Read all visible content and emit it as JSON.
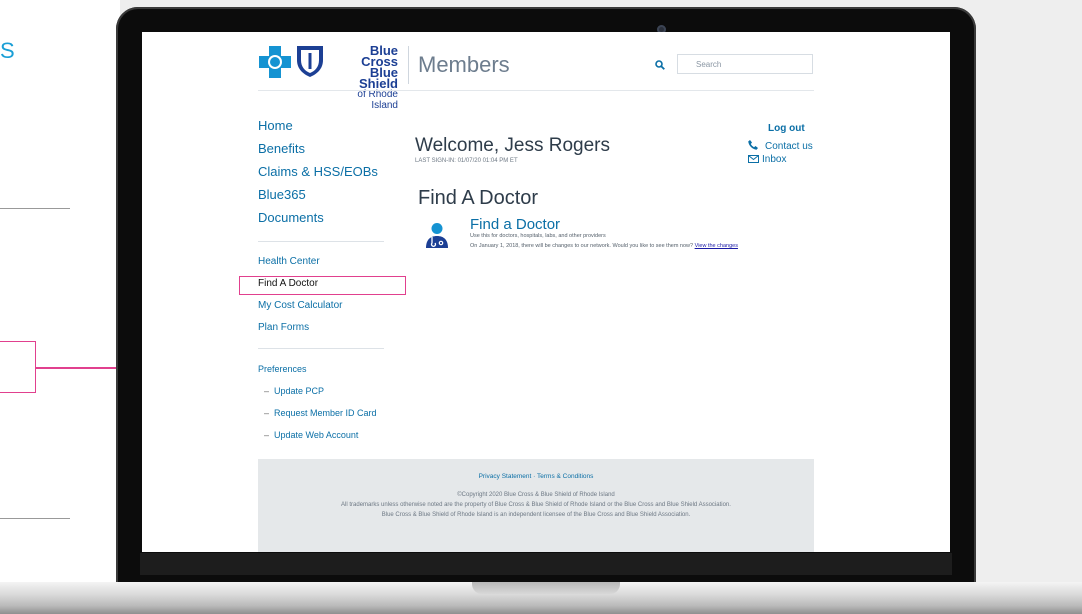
{
  "slide": {
    "fragment_letter": "S",
    "accent_color": "#1a9fd6",
    "highlight_color": "#e1408e"
  },
  "header": {
    "logo_line1": "Blue Cross",
    "logo_line2": "Blue Shield",
    "logo_line3": "of Rhode Island",
    "section_title": "Members",
    "search_placeholder": "Search"
  },
  "nav_primary": [
    {
      "label": "Home"
    },
    {
      "label": "Benefits"
    },
    {
      "label": "Claims & HSS/EOBs"
    },
    {
      "label": "Blue365"
    },
    {
      "label": "Documents"
    }
  ],
  "nav_secondary": [
    {
      "label": "Health Center"
    },
    {
      "label": "Find A Doctor",
      "active": true
    },
    {
      "label": "My Cost Calculator"
    },
    {
      "label": "Plan Forms"
    }
  ],
  "preferences": {
    "heading": "Preferences",
    "items": [
      {
        "label": "Update PCP"
      },
      {
        "label": "Request Member ID Card"
      },
      {
        "label": "Update Web Account"
      }
    ]
  },
  "welcome": {
    "greeting": "Welcome, Jess Rogers",
    "last_sign_in": "LAST SIGN-IN: 01/07/20 01:04 PM ET"
  },
  "account_links": {
    "logout": "Log out",
    "contact": "Contact us",
    "inbox": "Inbox"
  },
  "main": {
    "page_title": "Find A Doctor",
    "link_title": "Find a Doctor",
    "description": "Use this for doctors, hospitals, labs, and other providers",
    "notice_text": "On January 1, 2018, there will be changes to our network. Would you like to see them now?",
    "notice_link": "View the changes"
  },
  "footer": {
    "privacy": "Privacy Statement",
    "separator": "·",
    "terms": "Terms & Conditions",
    "copyright": "©Copyright 2020 Blue Cross & Blue Shield of Rhode Island",
    "trademarks": "All trademarks unless otherwise noted are the property of Blue Cross & Blue Shield of Rhode Island or the Blue Cross and Blue Shield Association.",
    "licensee": "Blue Cross & Blue Shield of Rhode Island is an independent licensee of the Blue Cross and Blue Shield Association."
  }
}
